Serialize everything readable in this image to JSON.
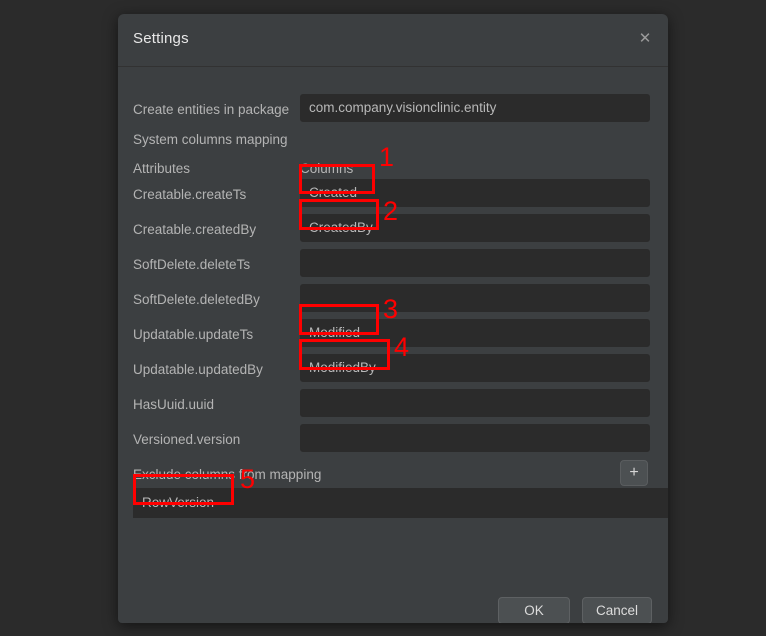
{
  "dialog": {
    "title": "Settings",
    "close_icon": "close-icon",
    "package": {
      "label": "Create entities in package",
      "value": "com.company.visionclinic.entity"
    },
    "system_columns_mapping_label": "System columns mapping",
    "table_headers": {
      "attributes": "Attributes",
      "columns": "Columns"
    },
    "mappings": [
      {
        "attribute": "Creatable.createTs",
        "column": "Created"
      },
      {
        "attribute": "Creatable.createdBy",
        "column": "CreatedBy"
      },
      {
        "attribute": "SoftDelete.deleteTs",
        "column": ""
      },
      {
        "attribute": "SoftDelete.deletedBy",
        "column": ""
      },
      {
        "attribute": "Updatable.updateTs",
        "column": "Modified"
      },
      {
        "attribute": "Updatable.updatedBy",
        "column": "ModifiedBy"
      },
      {
        "attribute": "HasUuid.uuid",
        "column": ""
      },
      {
        "attribute": "Versioned.version",
        "column": ""
      }
    ],
    "exclude": {
      "label": "Exclude columns from mapping",
      "add_icon": "plus-icon",
      "add_label": "+",
      "remove_icon": "minus-icon",
      "remove_label": "−",
      "items": [
        "RowVersion"
      ]
    },
    "footer": {
      "ok_label": "OK",
      "cancel_label": "Cancel"
    }
  },
  "annotations": [
    {
      "number": "1",
      "target": "Created"
    },
    {
      "number": "2",
      "target": "CreatedBy"
    },
    {
      "number": "3",
      "target": "Modified"
    },
    {
      "number": "4",
      "target": "ModifiedBy"
    },
    {
      "number": "5",
      "target": "RowVersion"
    }
  ],
  "colors": {
    "annotation": "#ff0000",
    "dialog_bg": "#3c3f41",
    "field_bg": "#2b2b2b",
    "page_bg": "#2b2b2b"
  }
}
